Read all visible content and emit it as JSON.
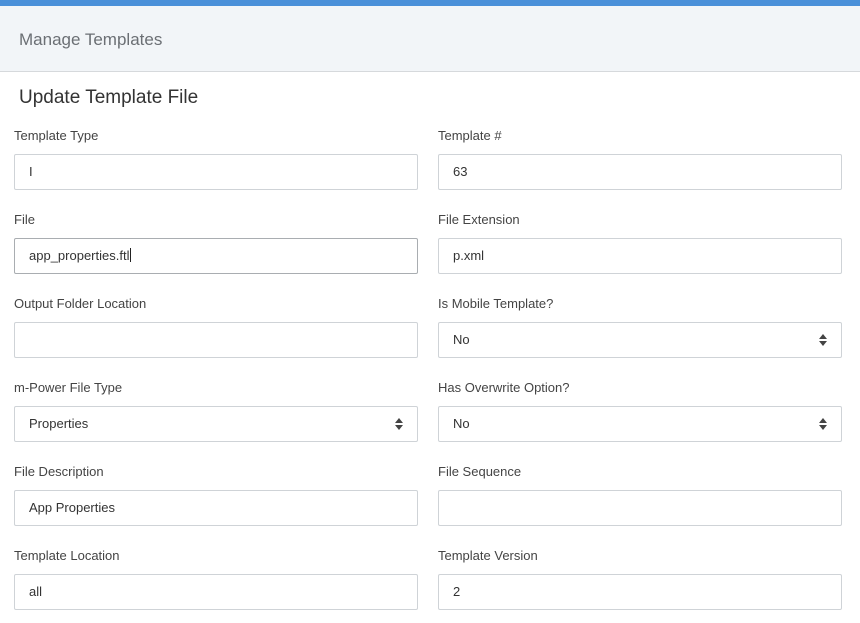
{
  "header": {
    "title": "Manage Templates"
  },
  "form": {
    "section_title": "Update Template File",
    "template_type": {
      "label": "Template Type",
      "value": "I"
    },
    "template_number": {
      "label": "Template #",
      "value": "63"
    },
    "file": {
      "label": "File",
      "value": "app_properties.ftl"
    },
    "file_extension": {
      "label": "File Extension",
      "value": "p.xml"
    },
    "output_folder": {
      "label": "Output Folder Location",
      "value": ""
    },
    "is_mobile": {
      "label": "Is Mobile Template?",
      "value": "No"
    },
    "file_type": {
      "label": "m-Power File Type",
      "value": "Properties"
    },
    "has_overwrite": {
      "label": "Has Overwrite Option?",
      "value": "No"
    },
    "file_description": {
      "label": "File Description",
      "value": "App Properties"
    },
    "file_sequence": {
      "label": "File Sequence",
      "value": ""
    },
    "template_location": {
      "label": "Template Location",
      "value": "all"
    },
    "template_version": {
      "label": "Template Version",
      "value": "2"
    }
  },
  "colors": {
    "accent": "#4a90d9",
    "header_bg": "#f2f5f8"
  }
}
